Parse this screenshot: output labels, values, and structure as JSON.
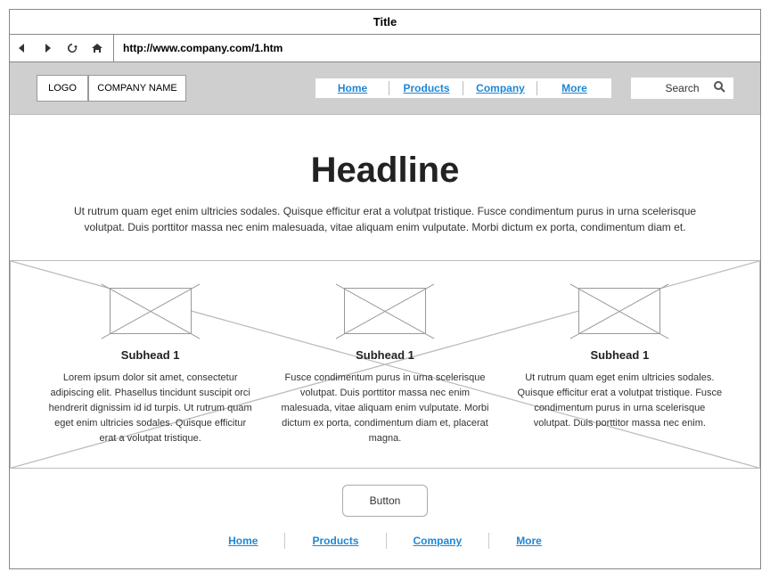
{
  "window": {
    "title": "Title"
  },
  "browser": {
    "url": "http://www.company.com/1.htm"
  },
  "header": {
    "logo_label": "LOGO",
    "company_label": "COMPANY NAME",
    "search_placeholder": "Search"
  },
  "nav": {
    "items": [
      {
        "label": "Home"
      },
      {
        "label": "Products"
      },
      {
        "label": "Company"
      },
      {
        "label": "More"
      }
    ]
  },
  "hero": {
    "headline": "Headline",
    "body": "Ut rutrum quam eget enim ultricies sodales. Quisque efficitur erat a volutpat tristique. Fusce condimentum purus in urna scelerisque volutpat. Duis porttitor massa nec enim malesuada, vitae aliquam enim vulputate. Morbi dictum ex porta, condimentum diam et."
  },
  "features": [
    {
      "title": "Subhead 1",
      "body": "Lorem ipsum dolor sit amet, consectetur adipiscing elit. Phasellus tincidunt suscipit orci hendrerit dignissim id id turpis. Ut rutrum quam eget enim ultricies sodales. Quisque efficitur erat a volutpat tristique."
    },
    {
      "title": "Subhead 1",
      "body": "Fusce condimentum purus in urna scelerisque volutpat. Duis porttitor massa nec enim malesuada, vitae aliquam enim vulputate. Morbi dictum ex porta, condimentum diam et, placerat magna."
    },
    {
      "title": "Subhead 1",
      "body": "Ut rutrum quam eget enim ultricies sodales. Quisque efficitur erat a volutpat tristique. Fusce condimentum purus in urna scelerisque volutpat. Duis porttitor massa nec enim."
    }
  ],
  "cta": {
    "button_label": "Button"
  },
  "footer": {
    "items": [
      {
        "label": "Home"
      },
      {
        "label": "Products"
      },
      {
        "label": "Company"
      },
      {
        "label": "More"
      }
    ]
  }
}
